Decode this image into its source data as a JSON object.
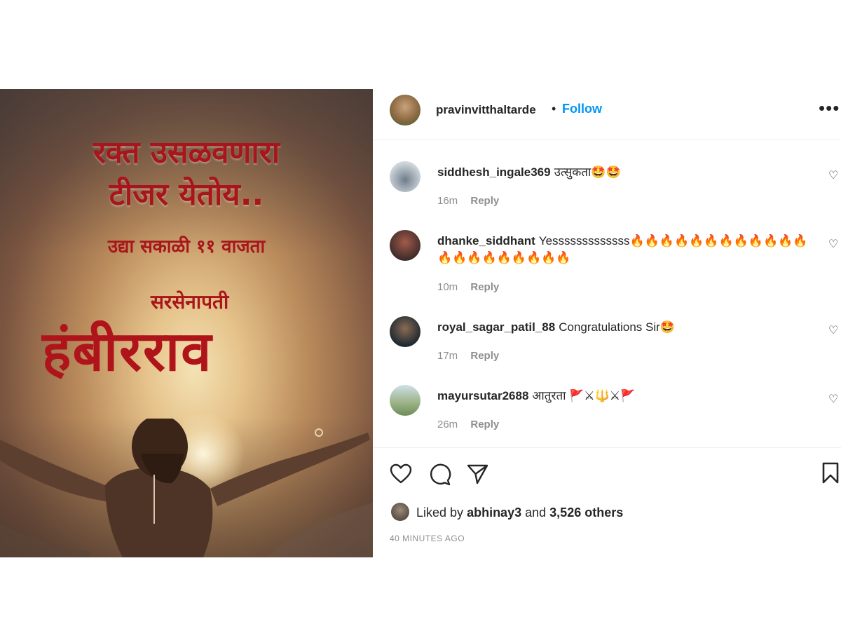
{
  "media": {
    "line1": "रक्त उसळवणारा",
    "line2": "टीजर येतोय..",
    "line3": "उद्या सकाळी ११ वाजता",
    "subtitle": "सरसेनापती",
    "title": "हंबीरराव"
  },
  "header": {
    "username": "pravinvitthaltarde",
    "separator": "•",
    "follow_label": "Follow",
    "more_icon": "more-options-icon"
  },
  "comments": [
    {
      "username": "siddhesh_ingale369",
      "text": "उत्सुकता🤩🤩",
      "time": "16m",
      "reply": "Reply"
    },
    {
      "username": "dhanke_siddhant",
      "text": "Yesssssssssssss🔥🔥🔥🔥🔥🔥🔥🔥🔥🔥🔥🔥🔥🔥🔥🔥🔥🔥🔥🔥🔥",
      "time": "10m",
      "reply": "Reply"
    },
    {
      "username": "royal_sagar_patil_88",
      "text": "Congratulations Sir🤩",
      "time": "17m",
      "reply": "Reply"
    },
    {
      "username": "mayursutar2688",
      "text": "आतुरता 🚩⚔🔱⚔🚩",
      "time": "26m",
      "reply": "Reply"
    }
  ],
  "actions": {
    "icons": [
      "heart-icon",
      "comment-icon",
      "share-icon",
      "bookmark-icon"
    ],
    "liked_prefix": "Liked by",
    "liked_user": "abhinay3",
    "liked_and": "and",
    "liked_others": "3,526 others",
    "timestamp": "40 MINUTES AGO"
  },
  "colors": {
    "accent": "#0095f6",
    "title_red": "#a8151b",
    "muted": "#8e8e8e"
  }
}
